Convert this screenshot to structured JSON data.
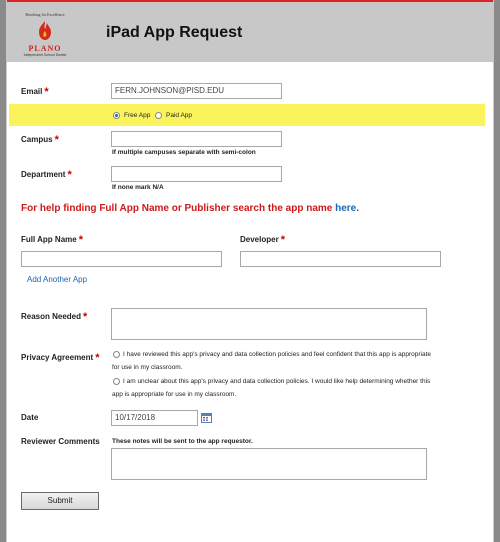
{
  "header": {
    "logo_tagline": "Reaching for Excellence",
    "logo_name": "PLANO",
    "logo_subtitle": "Independent School District",
    "title": "iPad App Request"
  },
  "form": {
    "email": {
      "label": "Email",
      "value": "FERN.JOHNSON@PISD.EDU"
    },
    "app_type": {
      "options": [
        "Free App",
        "Paid App"
      ],
      "selected": "Free App"
    },
    "campus": {
      "label": "Campus",
      "value": "",
      "hint": "If multiple campuses separate with semi-colon"
    },
    "department": {
      "label": "Department",
      "value": "",
      "hint": "If none mark N/A"
    },
    "help": {
      "text": "For help finding Full App Name or Publisher search the app name ",
      "link": "here",
      "period": "."
    },
    "full_app_name": {
      "label": "Full App Name",
      "value": ""
    },
    "developer": {
      "label": "Developer",
      "value": ""
    },
    "add_another_app": "Add Another App",
    "reason_needed": {
      "label": "Reason Needed",
      "value": ""
    },
    "privacy": {
      "label": "Privacy Agreement",
      "option1": [
        "I have reviewed this app's privacy and data collection policies and feel confident that this app is appropriate",
        "for use in my classroom."
      ],
      "option2": [
        "I am unclear about this app's privacy and data collection policies. I would like help determining whether this",
        "app is appropriate for use in my classroom."
      ]
    },
    "date": {
      "label": "Date",
      "value": "10/17/2018"
    },
    "reviewer_comments": {
      "label": "Reviewer Comments",
      "note": "These notes will be sent to the app requestor.",
      "value": ""
    },
    "submit_label": "Submit"
  },
  "colors": {
    "required": "#cc0000",
    "highlight": "#fbf35b",
    "link": "#1a66b5",
    "header_bg": "#c8c8c8"
  }
}
